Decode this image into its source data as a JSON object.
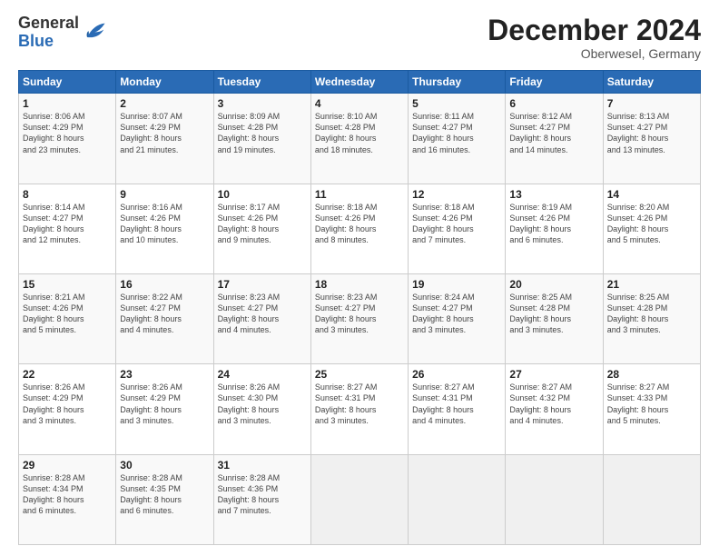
{
  "header": {
    "logo_general": "General",
    "logo_blue": "Blue",
    "month_title": "December 2024",
    "subtitle": "Oberwesel, Germany"
  },
  "weekdays": [
    "Sunday",
    "Monday",
    "Tuesday",
    "Wednesday",
    "Thursday",
    "Friday",
    "Saturday"
  ],
  "weeks": [
    [
      {
        "day": "1",
        "info": "Sunrise: 8:06 AM\nSunset: 4:29 PM\nDaylight: 8 hours\nand 23 minutes."
      },
      {
        "day": "2",
        "info": "Sunrise: 8:07 AM\nSunset: 4:29 PM\nDaylight: 8 hours\nand 21 minutes."
      },
      {
        "day": "3",
        "info": "Sunrise: 8:09 AM\nSunset: 4:28 PM\nDaylight: 8 hours\nand 19 minutes."
      },
      {
        "day": "4",
        "info": "Sunrise: 8:10 AM\nSunset: 4:28 PM\nDaylight: 8 hours\nand 18 minutes."
      },
      {
        "day": "5",
        "info": "Sunrise: 8:11 AM\nSunset: 4:27 PM\nDaylight: 8 hours\nand 16 minutes."
      },
      {
        "day": "6",
        "info": "Sunrise: 8:12 AM\nSunset: 4:27 PM\nDaylight: 8 hours\nand 14 minutes."
      },
      {
        "day": "7",
        "info": "Sunrise: 8:13 AM\nSunset: 4:27 PM\nDaylight: 8 hours\nand 13 minutes."
      }
    ],
    [
      {
        "day": "8",
        "info": "Sunrise: 8:14 AM\nSunset: 4:27 PM\nDaylight: 8 hours\nand 12 minutes."
      },
      {
        "day": "9",
        "info": "Sunrise: 8:16 AM\nSunset: 4:26 PM\nDaylight: 8 hours\nand 10 minutes."
      },
      {
        "day": "10",
        "info": "Sunrise: 8:17 AM\nSunset: 4:26 PM\nDaylight: 8 hours\nand 9 minutes."
      },
      {
        "day": "11",
        "info": "Sunrise: 8:18 AM\nSunset: 4:26 PM\nDaylight: 8 hours\nand 8 minutes."
      },
      {
        "day": "12",
        "info": "Sunrise: 8:18 AM\nSunset: 4:26 PM\nDaylight: 8 hours\nand 7 minutes."
      },
      {
        "day": "13",
        "info": "Sunrise: 8:19 AM\nSunset: 4:26 PM\nDaylight: 8 hours\nand 6 minutes."
      },
      {
        "day": "14",
        "info": "Sunrise: 8:20 AM\nSunset: 4:26 PM\nDaylight: 8 hours\nand 5 minutes."
      }
    ],
    [
      {
        "day": "15",
        "info": "Sunrise: 8:21 AM\nSunset: 4:26 PM\nDaylight: 8 hours\nand 5 minutes."
      },
      {
        "day": "16",
        "info": "Sunrise: 8:22 AM\nSunset: 4:27 PM\nDaylight: 8 hours\nand 4 minutes."
      },
      {
        "day": "17",
        "info": "Sunrise: 8:23 AM\nSunset: 4:27 PM\nDaylight: 8 hours\nand 4 minutes."
      },
      {
        "day": "18",
        "info": "Sunrise: 8:23 AM\nSunset: 4:27 PM\nDaylight: 8 hours\nand 3 minutes."
      },
      {
        "day": "19",
        "info": "Sunrise: 8:24 AM\nSunset: 4:27 PM\nDaylight: 8 hours\nand 3 minutes."
      },
      {
        "day": "20",
        "info": "Sunrise: 8:25 AM\nSunset: 4:28 PM\nDaylight: 8 hours\nand 3 minutes."
      },
      {
        "day": "21",
        "info": "Sunrise: 8:25 AM\nSunset: 4:28 PM\nDaylight: 8 hours\nand 3 minutes."
      }
    ],
    [
      {
        "day": "22",
        "info": "Sunrise: 8:26 AM\nSunset: 4:29 PM\nDaylight: 8 hours\nand 3 minutes."
      },
      {
        "day": "23",
        "info": "Sunrise: 8:26 AM\nSunset: 4:29 PM\nDaylight: 8 hours\nand 3 minutes."
      },
      {
        "day": "24",
        "info": "Sunrise: 8:26 AM\nSunset: 4:30 PM\nDaylight: 8 hours\nand 3 minutes."
      },
      {
        "day": "25",
        "info": "Sunrise: 8:27 AM\nSunset: 4:31 PM\nDaylight: 8 hours\nand 3 minutes."
      },
      {
        "day": "26",
        "info": "Sunrise: 8:27 AM\nSunset: 4:31 PM\nDaylight: 8 hours\nand 4 minutes."
      },
      {
        "day": "27",
        "info": "Sunrise: 8:27 AM\nSunset: 4:32 PM\nDaylight: 8 hours\nand 4 minutes."
      },
      {
        "day": "28",
        "info": "Sunrise: 8:27 AM\nSunset: 4:33 PM\nDaylight: 8 hours\nand 5 minutes."
      }
    ],
    [
      {
        "day": "29",
        "info": "Sunrise: 8:28 AM\nSunset: 4:34 PM\nDaylight: 8 hours\nand 6 minutes."
      },
      {
        "day": "30",
        "info": "Sunrise: 8:28 AM\nSunset: 4:35 PM\nDaylight: 8 hours\nand 6 minutes."
      },
      {
        "day": "31",
        "info": "Sunrise: 8:28 AM\nSunset: 4:36 PM\nDaylight: 8 hours\nand 7 minutes."
      },
      {
        "day": "",
        "info": ""
      },
      {
        "day": "",
        "info": ""
      },
      {
        "day": "",
        "info": ""
      },
      {
        "day": "",
        "info": ""
      }
    ]
  ]
}
